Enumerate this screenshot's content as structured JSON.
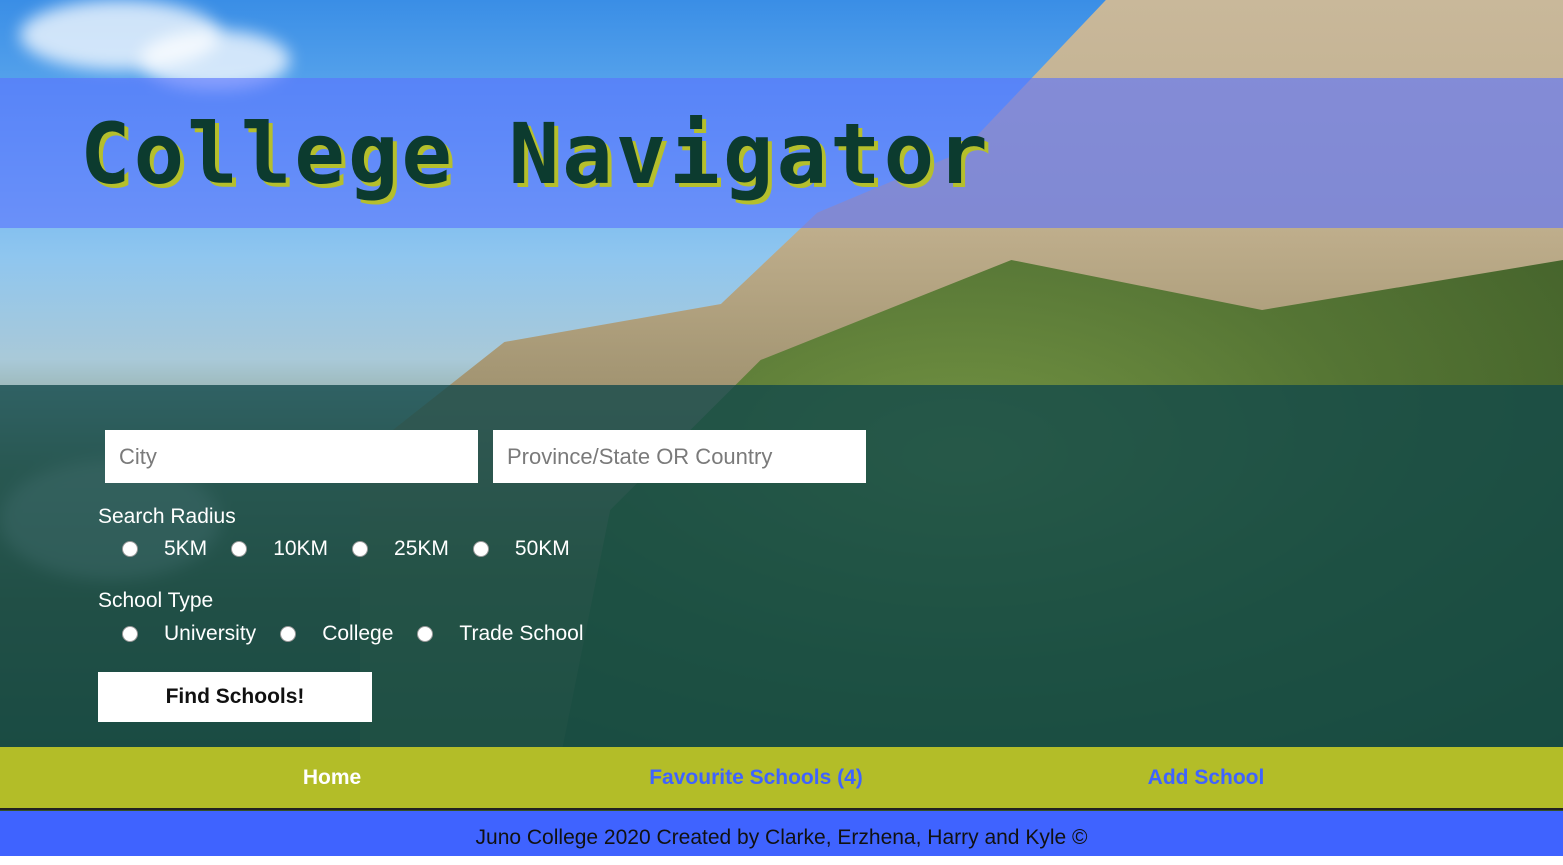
{
  "header": {
    "title": "College Navigator"
  },
  "search": {
    "city_placeholder": "City",
    "region_placeholder": "Province/State OR Country",
    "radius_label": "Search Radius",
    "radius_options": [
      "5KM",
      "10KM",
      "25KM",
      "50KM"
    ],
    "school_type_label": "School Type",
    "school_type_options": [
      "University",
      "College",
      "Trade School"
    ],
    "submit_label": "Find Schools!"
  },
  "nav": {
    "home": "Home",
    "favourites": "Favourite Schools (4)",
    "add_school": "Add School"
  },
  "footer": {
    "text": "Juno College 2020 Created by Clarke, Erzhena, Harry and Kyle ©"
  },
  "colors": {
    "header_band": "#5a73ff",
    "title_text": "#0c3b2f",
    "title_shadow": "#b5bf2c",
    "search_panel": "#11484a",
    "nav_bg": "#b3bd28",
    "nav_link_active": "#ffffff",
    "nav_link": "#3f63ff",
    "footer_bg": "#3f63ff"
  }
}
